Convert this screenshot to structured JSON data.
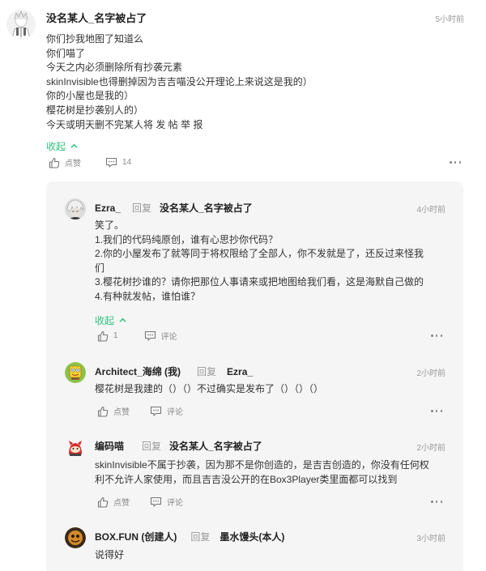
{
  "main": {
    "author": "没名某人_名字被占了",
    "time": "5小时前",
    "lines": [
      "你们抄我地图了知道么",
      "你们喵了",
      "今天之内必须删除所有抄袭元素",
      "skinInvisible也得删掉因为吉吉喵没公开理论上来说这是我的）",
      "你的小屋也是我的）",
      "樱花树是抄袭别人的）",
      "今天或明天删不完某人将 发 帖 举 报"
    ],
    "collapse_label": "收起",
    "like_label": "点赞",
    "comment_count": "14"
  },
  "replies": [
    {
      "author": "Ezra_",
      "verb": "回复",
      "target": "没名某人_名字被占了",
      "time": "4小时前",
      "lines": [
        "笑了。",
        "1.我们的代码纯原创，谁有心思抄你代码？",
        "2.你的小屋发布了就等同于将权限给了全部人，你不发就是了，还反过来怪我",
        "们",
        "3.樱花树抄谁的？请你把那位人事请来或把地图给我们看，这是海默自己做的",
        "4.有种就发帖，谁怕谁？"
      ],
      "collapse_label": "收起",
      "like_label": "1",
      "comment_label": "评论"
    },
    {
      "author": "Architect_海绵 (我)",
      "verb": "回复",
      "target": "Ezra_",
      "time": "2小时前",
      "lines": [
        "樱花树是我建的（）（）不过确实是发布了（）（）（）"
      ],
      "like_label": "点赞",
      "comment_label": "评论"
    },
    {
      "author": "编码喵",
      "verb": "回复",
      "target": "没名某人_名字被占了",
      "time": "2小时前",
      "lines": [
        "skinInvisible不属于抄袭，因为那不是你创造的，是吉吉创造的，你没有任何权",
        "利不允许人家使用，而且吉吉没公开的在Box3Player类里面都可以找到"
      ],
      "like_label": "点赞",
      "comment_label": "评论"
    },
    {
      "author": "BOX.FUN (创建人)",
      "verb": "回复",
      "target": "墨水馒头(本人)",
      "time": "3小时前",
      "lines": [
        "说得好"
      ]
    }
  ],
  "colors": {
    "accent": "#2ec27e",
    "reply_bg": "#f5f5f5",
    "muted": "#999999"
  },
  "icons": [
    "thumbs-up-icon",
    "comment-icon",
    "more-icon",
    "chevron-up-icon"
  ]
}
